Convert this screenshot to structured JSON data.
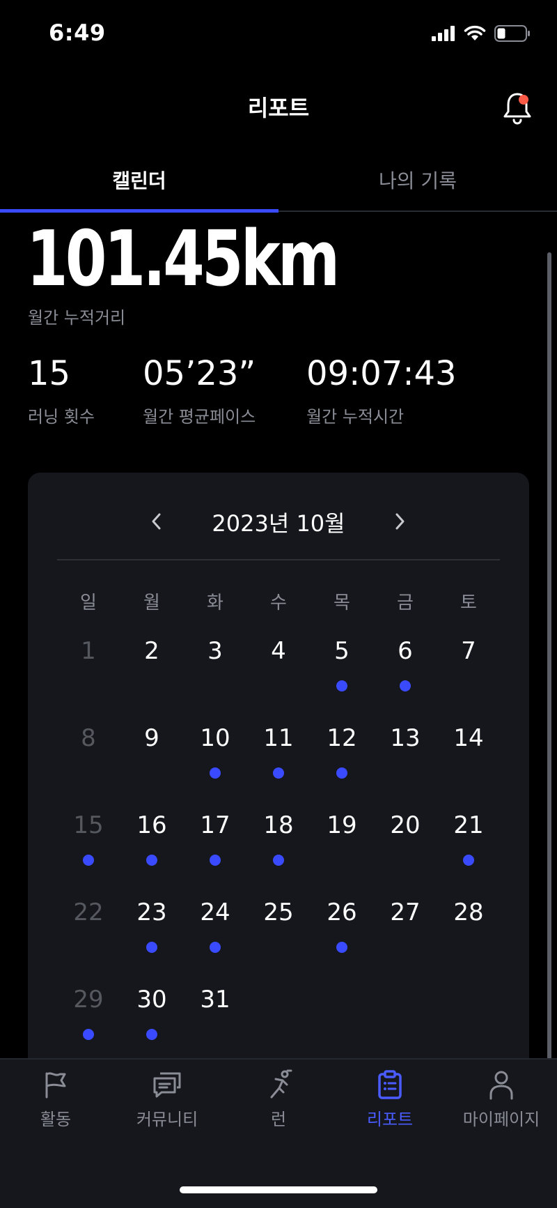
{
  "status_bar": {
    "time": "6:49",
    "icons": [
      "cellular-signal-icon",
      "wifi-icon",
      "battery-icon"
    ]
  },
  "header": {
    "title": "리포트",
    "notification_icon": "bell-icon",
    "has_unread": true
  },
  "tabs": [
    {
      "label": "캘린더",
      "active": true
    },
    {
      "label": "나의 기록",
      "active": false
    }
  ],
  "summary": {
    "distance": "101.45km",
    "distance_label": "월간 누적거리",
    "stats": [
      {
        "value": "15",
        "label": "러닝 횟수"
      },
      {
        "value": "05’23”",
        "label": "월간 평균페이스"
      },
      {
        "value": "09:07:43",
        "label": "월간 누적시간"
      }
    ]
  },
  "calendar": {
    "month_label": "2023년 10월",
    "weekdays": [
      "일",
      "월",
      "화",
      "수",
      "목",
      "금",
      "토"
    ],
    "days": [
      {
        "d": "1",
        "run": false
      },
      {
        "d": "2",
        "run": false
      },
      {
        "d": "3",
        "run": false
      },
      {
        "d": "4",
        "run": false
      },
      {
        "d": "5",
        "run": true
      },
      {
        "d": "6",
        "run": true
      },
      {
        "d": "7",
        "run": false
      },
      {
        "d": "8",
        "run": false
      },
      {
        "d": "9",
        "run": false
      },
      {
        "d": "10",
        "run": true
      },
      {
        "d": "11",
        "run": true
      },
      {
        "d": "12",
        "run": true
      },
      {
        "d": "13",
        "run": false
      },
      {
        "d": "14",
        "run": false
      },
      {
        "d": "15",
        "run": true
      },
      {
        "d": "16",
        "run": true
      },
      {
        "d": "17",
        "run": true
      },
      {
        "d": "18",
        "run": true
      },
      {
        "d": "19",
        "run": false
      },
      {
        "d": "20",
        "run": false
      },
      {
        "d": "21",
        "run": true
      },
      {
        "d": "22",
        "run": false
      },
      {
        "d": "23",
        "run": true
      },
      {
        "d": "24",
        "run": true
      },
      {
        "d": "25",
        "run": false
      },
      {
        "d": "26",
        "run": true
      },
      {
        "d": "27",
        "run": false
      },
      {
        "d": "28",
        "run": false
      },
      {
        "d": "29",
        "run": true
      },
      {
        "d": "30",
        "run": true
      },
      {
        "d": "31",
        "run": false
      }
    ]
  },
  "bottom_nav": [
    {
      "label": "활동",
      "icon": "flag-icon",
      "active": false
    },
    {
      "label": "커뮤니티",
      "icon": "chat-icon",
      "active": false
    },
    {
      "label": "런",
      "icon": "runner-icon",
      "active": false
    },
    {
      "label": "리포트",
      "icon": "clipboard-icon",
      "active": true
    },
    {
      "label": "마이페이지",
      "icon": "person-icon",
      "active": false
    }
  ],
  "colors": {
    "accent": "#3a4bff",
    "card": "#15171c",
    "muted_text": "#8a8d96"
  }
}
